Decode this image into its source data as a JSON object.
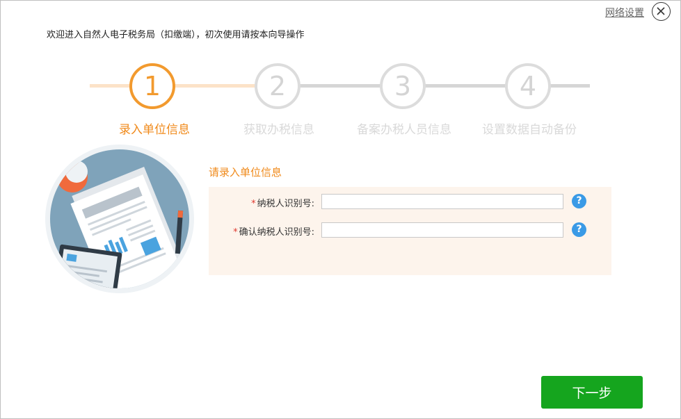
{
  "header": {
    "network_settings": "网络设置",
    "welcome_text": "欢迎进入自然人电子税务局（扣缴端），初次使用请按本向导操作"
  },
  "steps": [
    {
      "number": "1",
      "label": "录入单位信息",
      "state": "active"
    },
    {
      "number": "2",
      "label": "获取办税信息",
      "state": "todo"
    },
    {
      "number": "3",
      "label": "备案办税人员信息",
      "state": "todo"
    },
    {
      "number": "4",
      "label": "设置数据自动备份",
      "state": "todo"
    }
  ],
  "form": {
    "title": "请录入单位信息",
    "fields": [
      {
        "required_mark": "*",
        "label": "纳税人识别号:",
        "value": "",
        "help": "?"
      },
      {
        "required_mark": "*",
        "label": "确认纳税人识别号:",
        "value": "",
        "help": "?"
      }
    ]
  },
  "actions": {
    "next_label": "下一步"
  },
  "colors": {
    "accent": "#f29a2e",
    "step_label_active": "#f08a1b",
    "step_inactive": "#dcdcdc",
    "form_panel_bg": "#fdf4ec",
    "help_icon": "#3a9ae6",
    "next_button": "#15a51e",
    "required": "#e0382f"
  },
  "icons": {
    "close": "close-icon",
    "help": "question-icon",
    "illustration": "document-illustration"
  }
}
